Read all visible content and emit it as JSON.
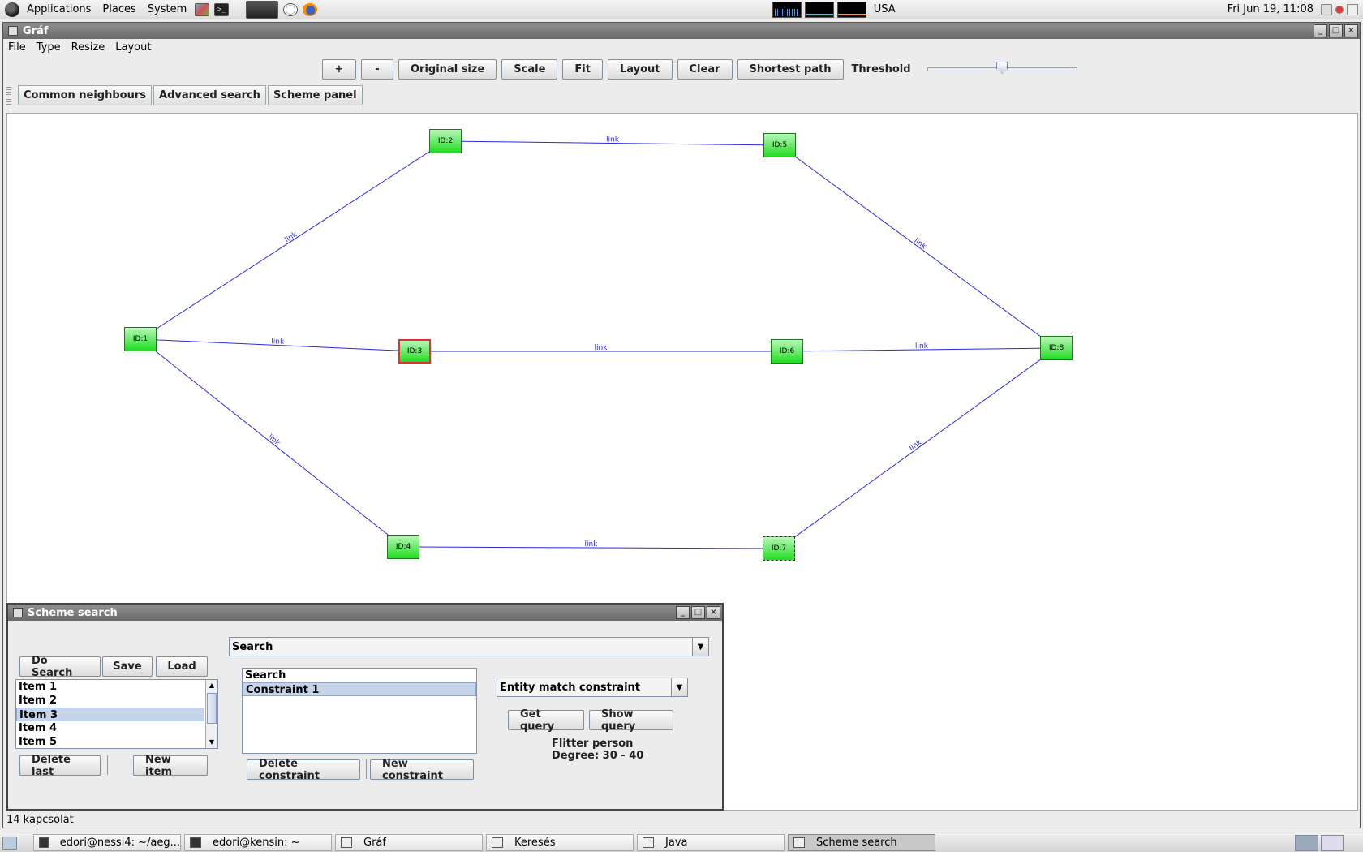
{
  "top_panel": {
    "menus": [
      "Applications",
      "Places",
      "System"
    ],
    "keyboard_layout": "USA",
    "clock": "Fri Jun 19, 11:08"
  },
  "main_window": {
    "title": "Gráf",
    "menu": [
      "File",
      "Type",
      "Resize",
      "Layout"
    ],
    "toolbar": {
      "zoom_in": "+",
      "zoom_out": "-",
      "original_size": "Original size",
      "scale": "Scale",
      "fit": "Fit",
      "layout": "Layout",
      "clear": "Clear",
      "shortest_path": "Shortest path",
      "threshold_label": "Threshold",
      "threshold_value": 0.5
    },
    "toolbar2": {
      "common_neighbours": "Common neighbours",
      "advanced_search": "Advanced search",
      "scheme_panel": "Scheme panel"
    },
    "graph": {
      "edge_color": "#2a2ae0",
      "node_color": "#22dd22",
      "selected_border_color": "#e03030",
      "nodes": [
        {
          "id": "ID:1",
          "state": "normal"
        },
        {
          "id": "ID:2",
          "state": "normal"
        },
        {
          "id": "ID:3",
          "state": "selected"
        },
        {
          "id": "ID:4",
          "state": "normal"
        },
        {
          "id": "ID:5",
          "state": "normal"
        },
        {
          "id": "ID:6",
          "state": "normal"
        },
        {
          "id": "ID:7",
          "state": "dashed"
        },
        {
          "id": "ID:8",
          "state": "normal"
        }
      ],
      "edges": [
        {
          "from": "ID:1",
          "to": "ID:2",
          "label": "link"
        },
        {
          "from": "ID:1",
          "to": "ID:3",
          "label": "link"
        },
        {
          "from": "ID:1",
          "to": "ID:4",
          "label": "link"
        },
        {
          "from": "ID:2",
          "to": "ID:5",
          "label": "link"
        },
        {
          "from": "ID:3",
          "to": "ID:6",
          "label": "link"
        },
        {
          "from": "ID:4",
          "to": "ID:7",
          "label": "link"
        },
        {
          "from": "ID:5",
          "to": "ID:8",
          "label": "link"
        },
        {
          "from": "ID:6",
          "to": "ID:8",
          "label": "link"
        },
        {
          "from": "ID:7",
          "to": "ID:8",
          "label": "link"
        }
      ]
    },
    "status": "14 kapcsolat"
  },
  "scheme_search": {
    "title": "Scheme search",
    "search_combo": "Search",
    "do_search": "Do Search",
    "save": "Save",
    "load": "Load",
    "items": [
      "Item 1",
      "Item 2",
      "Item 3",
      "Item 4",
      "Item 5"
    ],
    "selected_item_index": 2,
    "delete_last": "Delete last",
    "new_item": "New item",
    "constraint_header": "Search",
    "constraints": [
      "Constraint 1"
    ],
    "delete_constraint": "Delete constraint",
    "new_constraint": "New constraint",
    "constraint_type": "Entity match constraint",
    "get_query": "Get query",
    "show_query": "Show query",
    "info_line1": "Flitter person",
    "info_line2": "Degree: 30 - 40"
  },
  "taskbar": {
    "tasks": [
      "edori@nessi4: ~/aeg...",
      "edori@kensin: ~",
      "Gráf",
      "Keresés",
      "Java",
      "Scheme search"
    ],
    "active_index": 5
  }
}
